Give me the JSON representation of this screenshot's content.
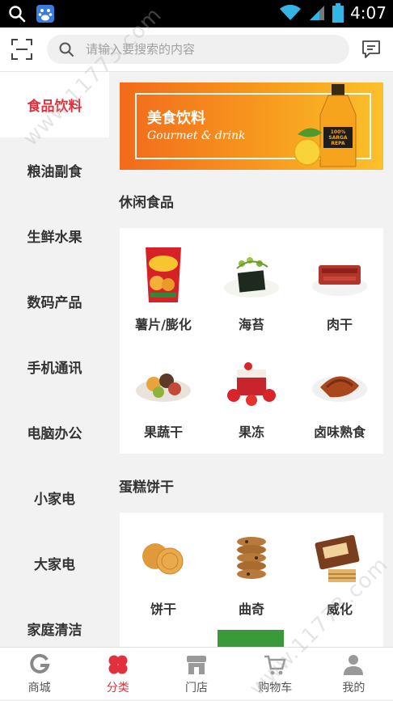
{
  "status_bar": {
    "time": "4:07"
  },
  "search": {
    "placeholder": "请输入要搜索的内容"
  },
  "sidebar": {
    "items": [
      {
        "label": "食品饮料",
        "active": true
      },
      {
        "label": "粮油副食"
      },
      {
        "label": "生鲜水果"
      },
      {
        "label": "数码产品"
      },
      {
        "label": "手机通讯"
      },
      {
        "label": "电脑办公"
      },
      {
        "label": "小家电"
      },
      {
        "label": "大家电"
      },
      {
        "label": "家庭清洁"
      }
    ]
  },
  "banner": {
    "title_cn": "美食饮料",
    "title_en": "Gourmet & drink",
    "bottle_text": "100% SARGA REPA"
  },
  "sections": [
    {
      "title": "休闲食品",
      "items": [
        {
          "label": "薯片/膨化",
          "icon": "chips-bag-icon"
        },
        {
          "label": "海苔",
          "icon": "seaweed-icon"
        },
        {
          "label": "肉干",
          "icon": "jerky-icon"
        },
        {
          "label": "果蔬干",
          "icon": "dried-fruit-icon"
        },
        {
          "label": "果冻",
          "icon": "jelly-icon"
        },
        {
          "label": "卤味熟食",
          "icon": "braised-meat-icon"
        }
      ]
    },
    {
      "title": "蛋糕饼干",
      "items": [
        {
          "label": "饼干",
          "icon": "biscuit-icon"
        },
        {
          "label": "曲奇",
          "icon": "cookie-icon"
        },
        {
          "label": "威化",
          "icon": "wafer-icon"
        }
      ]
    }
  ],
  "tabbar": {
    "items": [
      {
        "label": "商城",
        "icon": "mall-icon"
      },
      {
        "label": "分类",
        "icon": "category-icon",
        "active": true
      },
      {
        "label": "门店",
        "icon": "store-icon"
      },
      {
        "label": "购物车",
        "icon": "cart-icon"
      },
      {
        "label": "我的",
        "icon": "profile-icon"
      }
    ]
  },
  "watermark": "www.11773.com",
  "colors": {
    "accent": "#e0313c",
    "banner_orange": "#f7a21b"
  }
}
